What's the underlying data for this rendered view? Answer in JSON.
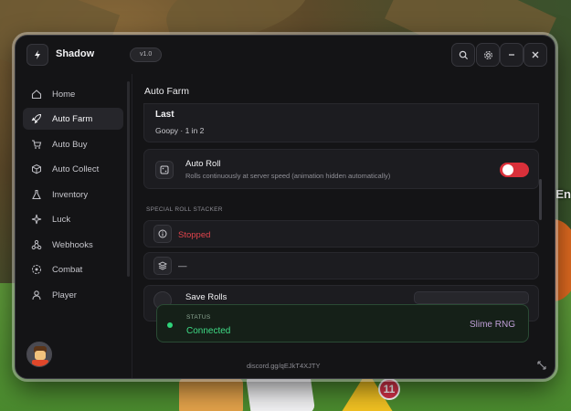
{
  "window": {
    "app_title": "Shadow",
    "version": "v1.0"
  },
  "sidebar": {
    "items": [
      {
        "label": "Home",
        "icon": "home-icon",
        "active": false
      },
      {
        "label": "Auto Farm",
        "icon": "rocket-icon",
        "active": true
      },
      {
        "label": "Auto Buy",
        "icon": "cart-icon",
        "active": false
      },
      {
        "label": "Auto Collect",
        "icon": "box-icon",
        "active": false
      },
      {
        "label": "Inventory",
        "icon": "flask-icon",
        "active": false
      },
      {
        "label": "Luck",
        "icon": "sparkle-icon",
        "active": false
      },
      {
        "label": "Webhooks",
        "icon": "webhook-icon",
        "active": false
      },
      {
        "label": "Combat",
        "icon": "target-icon",
        "active": false
      },
      {
        "label": "Player",
        "icon": "user-icon",
        "active": false
      }
    ]
  },
  "main": {
    "title": "Auto Farm",
    "last_card": {
      "title": "Last",
      "value": "Goopy · 1 in 2"
    },
    "auto_roll": {
      "title": "Auto Roll",
      "description": "Rolls continuously at server speed (animation hidden automatically)",
      "enabled": true
    },
    "section_label": "SPECIAL ROLL STACKER",
    "stopped_card": {
      "text": "Stopped"
    },
    "stack_card": {
      "text": "—"
    },
    "save_rolls": {
      "title": "Save Rolls"
    }
  },
  "status": {
    "label": "STATUS",
    "value": "Connected",
    "game": "Slime RNG"
  },
  "footer": {
    "link": "discord.gg/qEJkT4XJTY"
  },
  "background": {
    "badge_count": "11",
    "side_text": "/ En"
  },
  "colors": {
    "accent_red": "#d9303a",
    "status_green": "#3fdc86",
    "game_purple": "#c09fd8",
    "stopped_red": "#e0444c"
  }
}
